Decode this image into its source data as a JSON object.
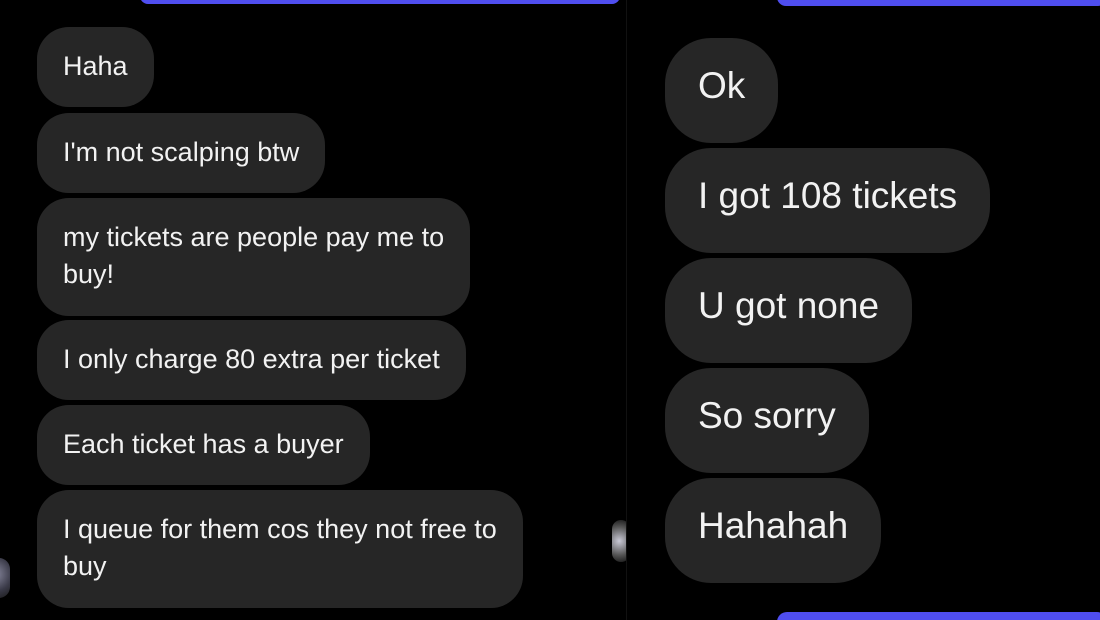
{
  "left_panel": {
    "messages": [
      {
        "text": "Haha"
      },
      {
        "text": "I'm not scalping btw"
      },
      {
        "text": "my tickets are people pay me to\nbuy!"
      },
      {
        "text": "I only charge 80 extra per ticket"
      },
      {
        "text": "Each ticket has a buyer"
      },
      {
        "text": "I queue for them cos they not free to\nbuy"
      }
    ]
  },
  "right_panel": {
    "messages": [
      {
        "text": "Ok"
      },
      {
        "text": "I got 108 tickets"
      },
      {
        "text": "U got none"
      },
      {
        "text": "So sorry"
      },
      {
        "text": "Hahahah"
      }
    ]
  },
  "colors": {
    "background": "#000000",
    "received_bubble": "#262626",
    "sent_bubble_edge": "#4f4ef0",
    "text": "#f2f2f2"
  }
}
